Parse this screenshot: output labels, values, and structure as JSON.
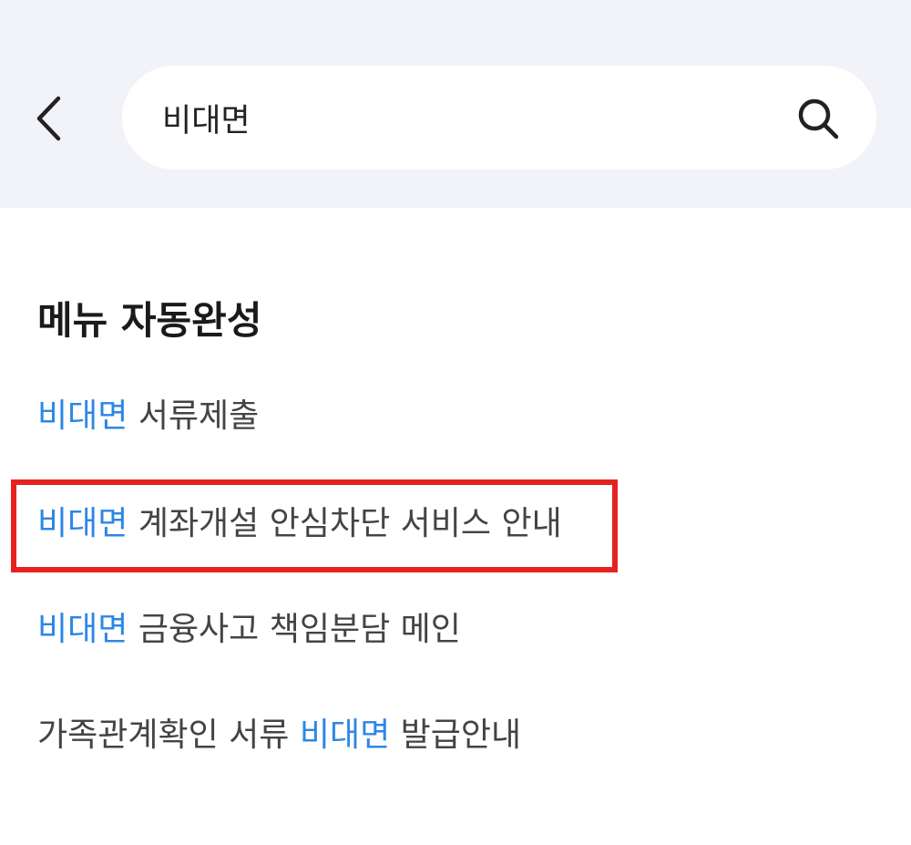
{
  "search": {
    "query": "비대면"
  },
  "autocomplete": {
    "title": "메뉴 자동완성",
    "items": [
      {
        "before": "",
        "highlight": "비대면",
        "after": " 서류제출"
      },
      {
        "before": "",
        "highlight": "비대면",
        "after": " 계좌개설 안심차단 서비스 안내"
      },
      {
        "before": "",
        "highlight": "비대면",
        "after": " 금융사고 책임분담 메인"
      },
      {
        "before": "가족관계확인 서류 ",
        "highlight": "비대면",
        "after": " 발급안내"
      }
    ]
  },
  "icons": {
    "back": "chevron-left-icon",
    "search": "search-icon"
  },
  "colors": {
    "header_bg": "#f2f3f8",
    "highlight_text": "#2d86e6",
    "annotation_border": "#e52222"
  }
}
